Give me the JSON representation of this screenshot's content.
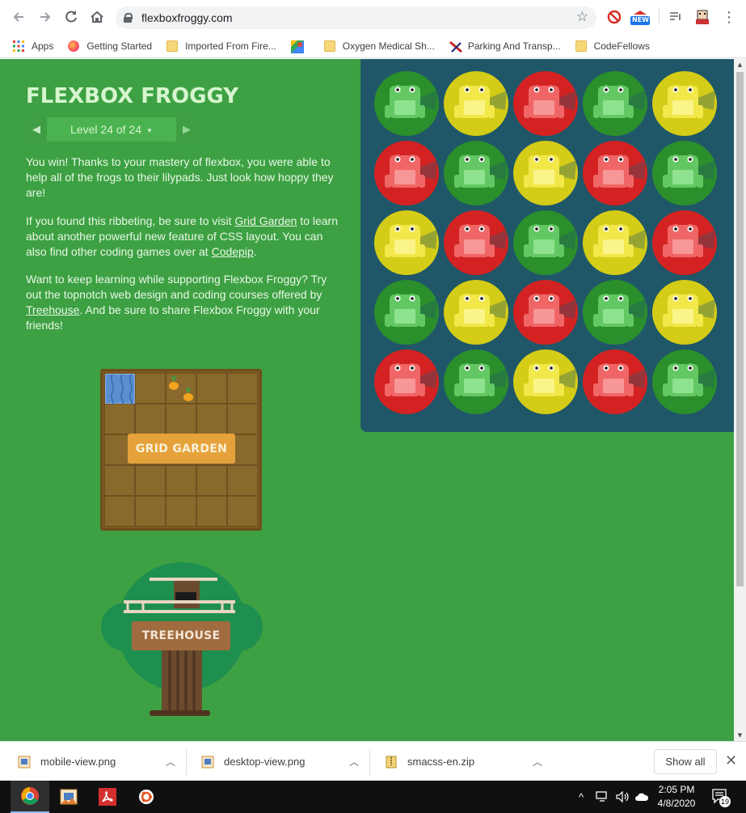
{
  "browser": {
    "url": "flexboxfroggy.com",
    "ext_badge": "NEW",
    "bookmarks": [
      {
        "label": "Apps",
        "icon": "apps-grid-icon"
      },
      {
        "label": "Getting Started",
        "icon": "firefox-icon"
      },
      {
        "label": "Imported From Fire...",
        "icon": "folder-icon"
      },
      {
        "label": "",
        "icon": "google-maps-icon"
      },
      {
        "label": "Oxygen Medical Sh...",
        "icon": "folder-icon"
      },
      {
        "label": "Parking And Transp...",
        "icon": "parking-icon"
      },
      {
        "label": "CodeFellows",
        "icon": "folder-icon"
      }
    ]
  },
  "game": {
    "title": "FLEXBOX FROGGY",
    "level_label": "Level 24 of 24",
    "para1": "You win! Thanks to your mastery of flexbox, you were able to help all of the frogs to their lilypads. Just look how hoppy they are!",
    "para2_pre": "If you found this ribbeting, be sure to visit ",
    "para2_link1": "Grid Garden",
    "para2_mid": " to learn about another powerful new feature of CSS layout. You can also find other coding games over at ",
    "para2_link2": "Codepip",
    "para2_post": ".",
    "para3_pre": "Want to keep learning while supporting Flexbox Froggy? Try out the topnotch web design and coding courses offered by ",
    "para3_link": "Treehouse",
    "para3_post": ". And be sure to share Flexbox Froggy with your friends!",
    "grid_garden_label": "GRID GARDEN",
    "treehouse_label": "TREEHOUSE"
  },
  "pond": {
    "colors": {
      "green": "#2b8f2b",
      "yellow": "#d4cc17",
      "red": "#d42222"
    },
    "frogs": [
      [
        "green",
        "yellow",
        "red",
        "green",
        "yellow"
      ],
      [
        "red",
        "green",
        "yellow",
        "red",
        "green"
      ],
      [
        "yellow",
        "red",
        "green",
        "yellow",
        "red"
      ],
      [
        "green",
        "yellow",
        "red",
        "green",
        "yellow"
      ],
      [
        "red",
        "green",
        "yellow",
        "red",
        "green"
      ]
    ]
  },
  "downloads": [
    {
      "name": "mobile-view.png"
    },
    {
      "name": "desktop-view.png"
    },
    {
      "name": "smacss-en.zip"
    }
  ],
  "shelf": {
    "show_all": "Show all"
  },
  "taskbar": {
    "time": "2:05 PM",
    "date": "4/8/2020",
    "notifications": "19"
  }
}
